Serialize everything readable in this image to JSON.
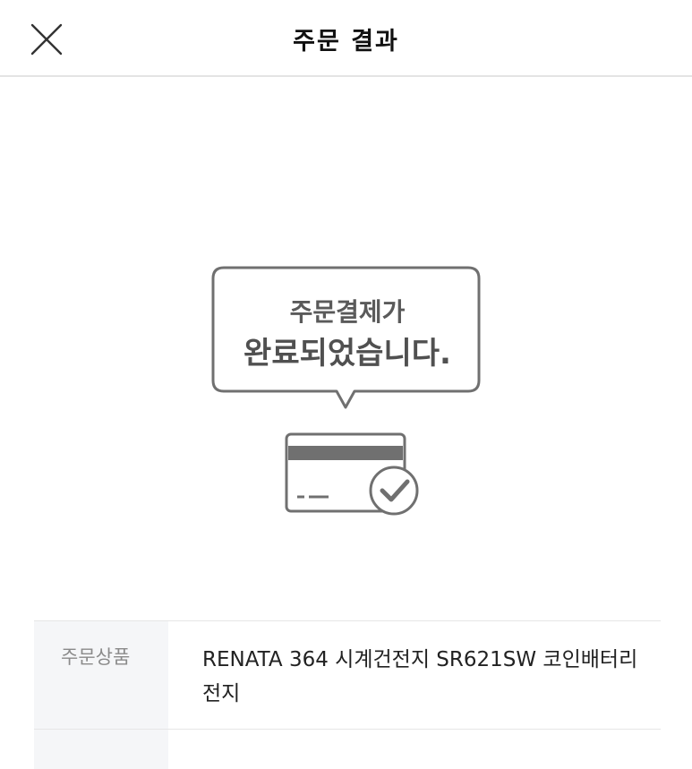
{
  "header": {
    "title": "주문 결과"
  },
  "result": {
    "line1": "주문결제가",
    "line2": "완료되었습니다."
  },
  "order_info": {
    "rows": [
      {
        "label": "주문상품",
        "value": "RENATA 364 시계건전지 SR621SW 코인배터리 전지"
      }
    ]
  },
  "colors": {
    "outline": "#707070",
    "label_bg": "#f5f6f8"
  },
  "icons": {
    "close": "close-icon",
    "card": "credit-card-icon",
    "check": "check-circle-icon"
  }
}
